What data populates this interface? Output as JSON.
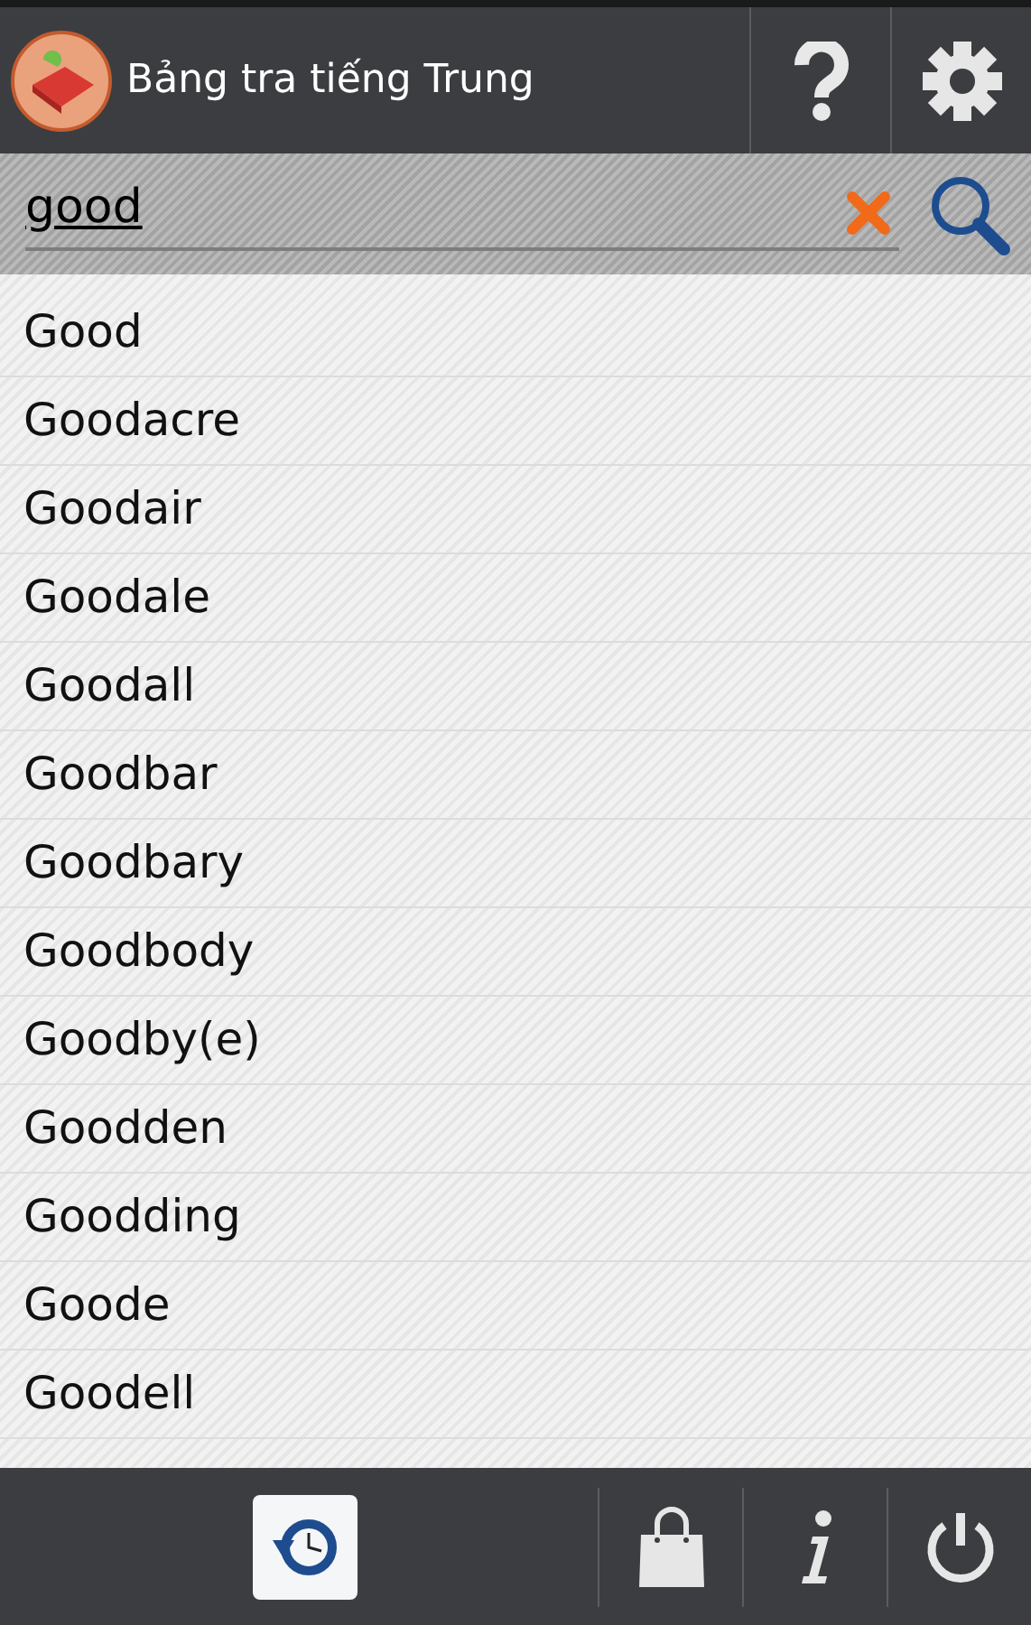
{
  "app_bar": {
    "title": "Bảng tra tiếng Trung",
    "actions": [
      {
        "kind": "help"
      },
      {
        "kind": "settings"
      }
    ]
  },
  "search": {
    "value": "good"
  },
  "results": [
    "Good",
    "Goodacre",
    "Goodair",
    "Goodale",
    "Goodall",
    "Goodbar",
    "Goodbary",
    "Goodbody",
    "Goodby(e)",
    "Goodden",
    "Goodding",
    "Goode",
    "Goodell"
  ],
  "bottom_bar": [
    {
      "kind": "history",
      "selected": true
    },
    {
      "kind": "store",
      "selected": false
    },
    {
      "kind": "info",
      "selected": false
    },
    {
      "kind": "power",
      "selected": false
    }
  ]
}
